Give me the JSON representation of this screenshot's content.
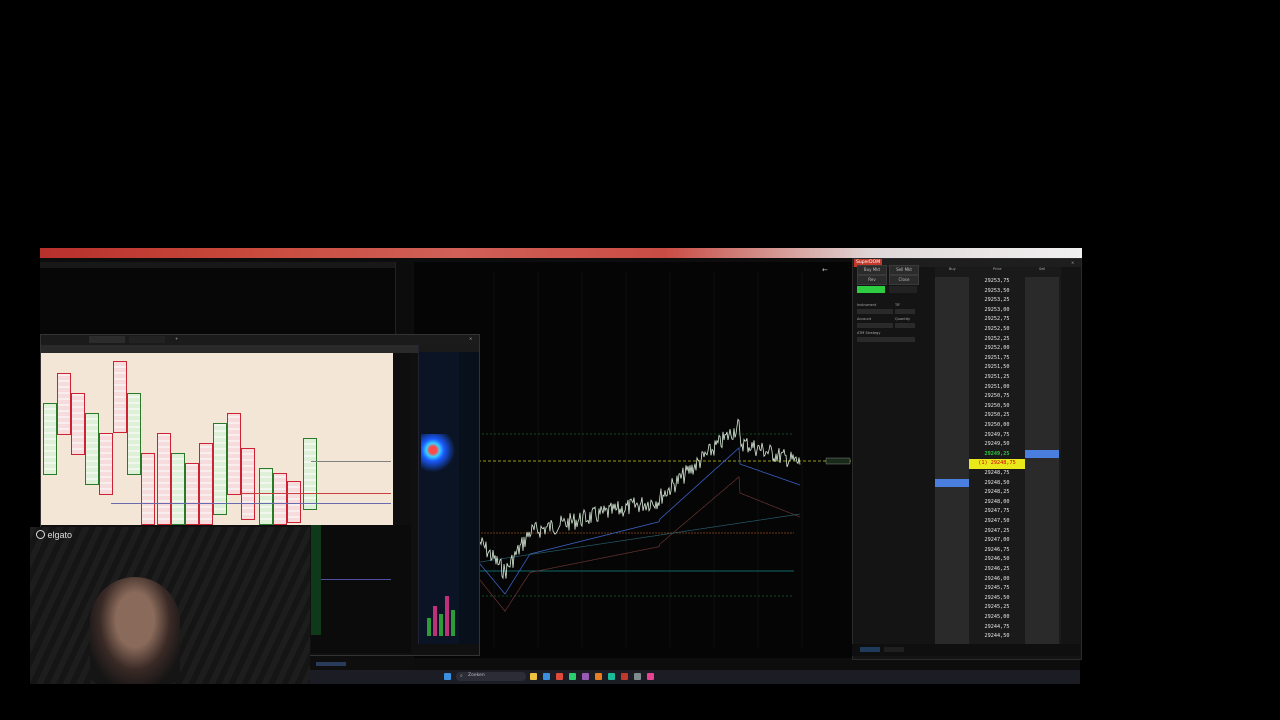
{
  "superdom": {
    "title": "SuperDOM",
    "buttons": {
      "buy_mkt": "Buy Mkt",
      "sell_mkt": "Sell Mkt",
      "rev": "Rev",
      "close": "Close"
    },
    "labels": {
      "instrument": "Instrument",
      "account": "Account",
      "quantity": "Quantity",
      "atm_strategy": "ATM Strategy",
      "tif": "TIF"
    },
    "column_headers": {
      "buy": "Buy",
      "price": "Price",
      "sell": "Sell"
    },
    "prices": [
      "29253,75",
      "29253,50",
      "29253,25",
      "29253,00",
      "29252,75",
      "29252,50",
      "29252,25",
      "29252,00",
      "29251,75",
      "29251,50",
      "29251,25",
      "29251,00",
      "29250,75",
      "29250,50",
      "29250,25",
      "29250,00",
      "29249,75",
      "29249,50",
      "29249,25",
      "29249,00",
      "29248,75",
      "29248,50",
      "29248,25",
      "29248,00",
      "29247,75",
      "29247,50",
      "29247,25",
      "29247,00",
      "29246,75",
      "29246,50",
      "29246,25",
      "29246,00",
      "29245,75",
      "29245,50",
      "29245,25",
      "29245,00",
      "29244,75",
      "29244,50"
    ],
    "last_price": "29249,25",
    "position_label": "(1) 29248,75",
    "position_index": 20,
    "last_index": 18,
    "bid_marker_index": 21,
    "ask_marker_index": 18,
    "accent_green": "#2ecc40",
    "accent_yellow": "#e8e81a",
    "accent_blue": "#4a7fe0"
  },
  "webcam": {
    "brand": "elgato"
  },
  "colors": {
    "chart_bg": "#050505",
    "price_line": "#d8ead8",
    "ema_blue": "#3a5fc0",
    "vwap_orange": "#d2691e",
    "level_yellow": "#c8c81e",
    "level_cyan": "#1ec8c8",
    "footprint_bg": "#f4e6d6"
  },
  "taskbar": {
    "search_placeholder": "Zoeken",
    "icons": [
      "start-icon",
      "search-icon",
      "file-explorer-icon",
      "edge-icon",
      "chrome-icon",
      "store-icon",
      "mail-icon",
      "ninjatrader-icon",
      "settings-icon",
      "app-icon",
      "app-icon-2",
      "app-icon-3"
    ]
  }
}
